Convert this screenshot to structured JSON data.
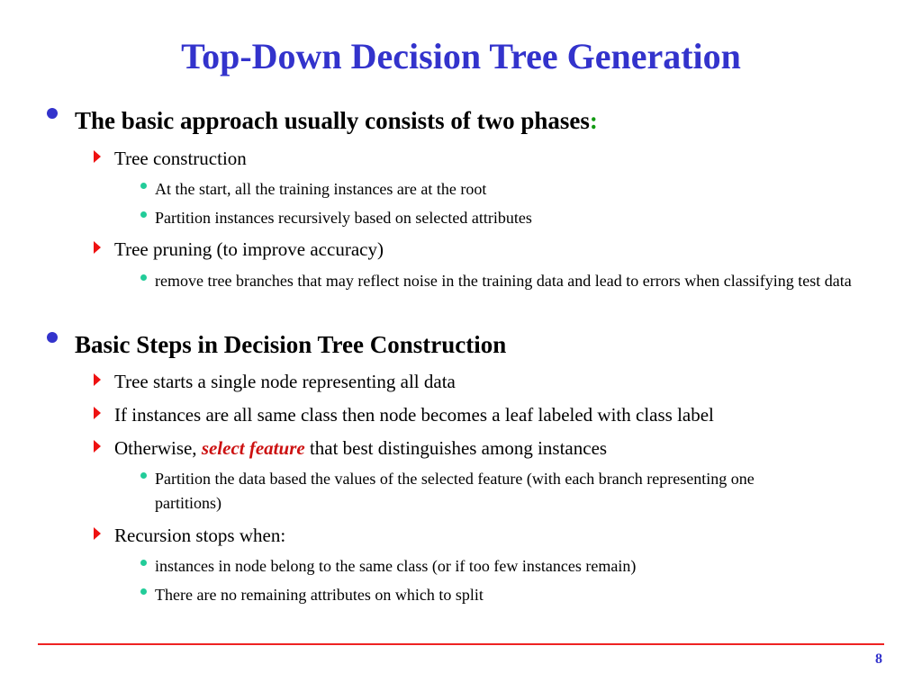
{
  "slide": {
    "title": "Top-Down Decision Tree Generation",
    "page_number": "8",
    "colors": {
      "title": "#3333cc",
      "level1_bullet": "#3333cc",
      "level2_bullet": "#ee1111",
      "level3_bullet": "#22cc99",
      "emphasis": "#cc1111",
      "colon_accent": "#119911",
      "footer_rule": "#ee2222"
    },
    "sections": [
      {
        "heading": "The basic approach usually consists of two phases",
        "heading_suffix": ":",
        "items": [
          {
            "text": "Tree construction",
            "subitems": [
              "At the start, all the training instances are at the root",
              "Partition instances recursively based on selected attributes"
            ]
          },
          {
            "text": "Tree pruning (to improve accuracy)",
            "subitems": [
              "remove tree branches that may reflect noise in the training data and lead to errors when classifying test data"
            ]
          }
        ]
      },
      {
        "heading": "Basic Steps in Decision Tree Construction",
        "items": [
          {
            "text": "Tree starts a single node representing all data"
          },
          {
            "text": "If instances are all same class then node becomes a leaf labeled with class label"
          },
          {
            "text_prefix": "Otherwise, ",
            "text_emphasis": "select feature",
            "text_suffix": " that best distinguishes among instances",
            "subitems": [
              "Partition the data based the values of the selected feature (with each branch representing one partitions)"
            ]
          },
          {
            "text": "Recursion stops when:",
            "subitems": [
              "instances in node belong to the same class (or if too few instances remain)",
              "There are no remaining attributes on which to split"
            ]
          }
        ]
      }
    ]
  }
}
